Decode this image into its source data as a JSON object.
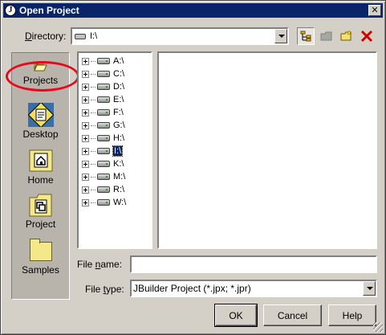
{
  "window": {
    "title": "Open Project",
    "close_glyph": "✕"
  },
  "directory": {
    "label_accel": "D",
    "label_rest": "irectory:",
    "value": "I:\\"
  },
  "toolbar": {
    "icons": [
      "tree-view-icon",
      "folder-up-icon",
      "new-folder-icon",
      "delete-icon"
    ]
  },
  "sidebar": {
    "items": [
      {
        "label": "Projects",
        "icon": "open-folder-icon"
      },
      {
        "label": "Desktop",
        "icon": "desktop-icon"
      },
      {
        "label": "Home",
        "icon": "home-icon"
      },
      {
        "label": "Project",
        "icon": "project-icon"
      },
      {
        "label": "Samples",
        "icon": "folder-icon"
      }
    ]
  },
  "tree": {
    "drives": [
      "A:\\",
      "C:\\",
      "D:\\",
      "E:\\",
      "F:\\",
      "G:\\",
      "H:\\",
      "I:\\",
      "K:\\",
      "M:\\",
      "R:\\",
      "W:\\"
    ],
    "selected": "I:\\"
  },
  "file_name": {
    "label_before": "File ",
    "label_accel": "n",
    "label_after": "ame:",
    "value": ""
  },
  "file_type": {
    "label_before": "File ",
    "label_accel": "t",
    "label_after": "ype:",
    "value": "JBuilder Project (*.jpx; *.jpr)"
  },
  "buttons": {
    "ok": "OK",
    "cancel": "Cancel",
    "help": "Help"
  },
  "annotation": {
    "color": "#e8081a"
  }
}
